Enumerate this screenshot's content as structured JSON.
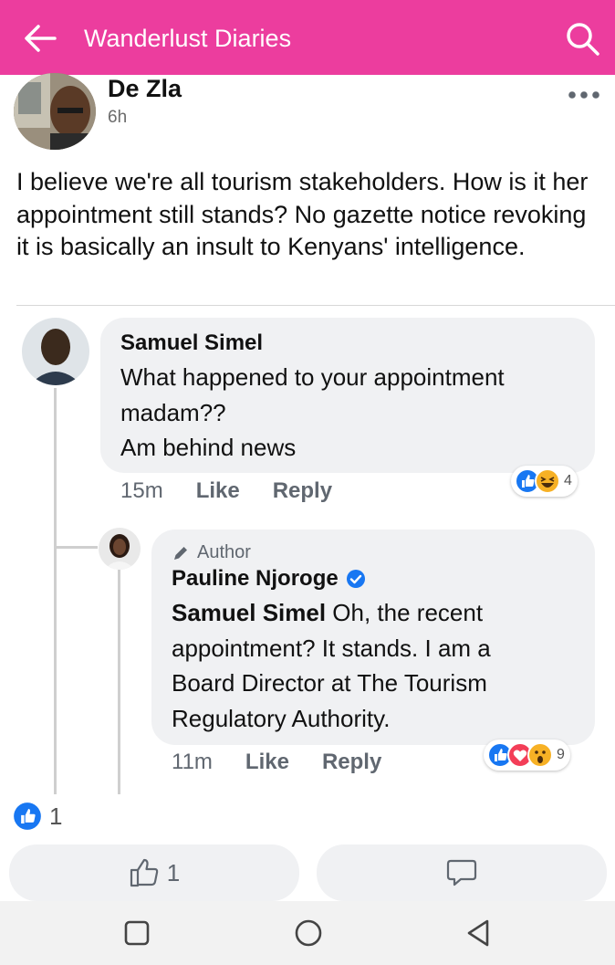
{
  "header": {
    "title": "Wanderlust Diaries"
  },
  "post": {
    "author": "De Zla",
    "time": "6h",
    "text": "I believe we're all tourism stakeholders. How is it her appointment still stands? No gazette notice revoking it is basically an insult to Kenyans' intelligence."
  },
  "comments": [
    {
      "author": "Samuel Simel",
      "text_line1": "What happened to your appointment",
      "text_line2": "madam??",
      "text_line3": "Am behind news",
      "time": "15m",
      "like_label": "Like",
      "reply_label": "Reply",
      "reactions": [
        "like",
        "haha"
      ],
      "reaction_count": "4"
    },
    {
      "badge": "Author",
      "author": "Pauline Njoroge",
      "verified": true,
      "mention": "Samuel Simel",
      "text_rest": " Oh, the recent",
      "text_line2": "appointment? It stands. I am a",
      "text_line3": "Board Director at The Tourism",
      "text_line4": "Regulatory Authority.",
      "time": "11m",
      "like_label": "Like",
      "reply_label": "Reply",
      "reactions": [
        "like",
        "love",
        "wow"
      ],
      "reaction_count": "9"
    }
  ],
  "post_reactions": {
    "count": "1"
  },
  "actions": {
    "like_count": "1"
  },
  "colors": {
    "header": "#ec3d9e",
    "like_blue": "#1877f2",
    "love_red": "#f33e58",
    "haha_yellow": "#f7b125"
  },
  "icons": [
    "back-arrow-icon",
    "search-icon",
    "more-icon",
    "thumbs-up-icon",
    "comment-icon",
    "verified-icon",
    "pencil-icon",
    "square-nav-icon",
    "circle-nav-icon",
    "triangle-nav-icon"
  ]
}
